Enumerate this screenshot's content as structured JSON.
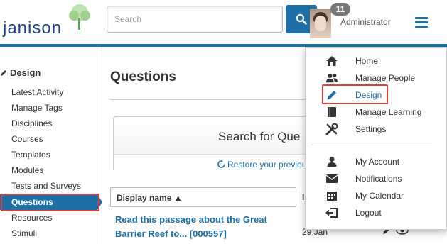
{
  "header": {
    "logo_text": "janison",
    "search_placeholder": "Search",
    "notification_count": "11",
    "username": "Administrator"
  },
  "sidebar": {
    "title": "Design",
    "items": [
      {
        "label": "Latest Activity"
      },
      {
        "label": "Manage Tags"
      },
      {
        "label": "Disciplines"
      },
      {
        "label": "Courses"
      },
      {
        "label": "Templates"
      },
      {
        "label": "Modules"
      },
      {
        "label": "Tests and Surveys"
      },
      {
        "label": "Questions",
        "active": true
      },
      {
        "label": "Resources"
      },
      {
        "label": "Stimuli"
      }
    ]
  },
  "main": {
    "title": "Questions",
    "search_panel_title": "Search for Que",
    "restore_link": "Restore your previou",
    "table": {
      "col_display_name": "Display name ▲",
      "col_second": "I",
      "rows": [
        {
          "name": "Read this passage about the Great Barrier Reef to... [000557]",
          "date": "29 Jan"
        }
      ]
    }
  },
  "dropdown": {
    "items": [
      {
        "label": "Home",
        "icon": "home-icon"
      },
      {
        "label": "Manage People",
        "icon": "people-icon"
      },
      {
        "label": "Design",
        "icon": "pencil-icon",
        "selected": true
      },
      {
        "label": "Manage Learning",
        "icon": "book-icon"
      },
      {
        "label": "Settings",
        "icon": "tools-icon"
      },
      {
        "label": "My Account",
        "icon": "user-icon"
      },
      {
        "label": "Notifications",
        "icon": "envelope-icon"
      },
      {
        "label": "My Calendar",
        "icon": "calendar-icon"
      },
      {
        "label": "Logout",
        "icon": "logout-icon"
      }
    ]
  },
  "colors": {
    "primary": "#1d6fa5",
    "highlight": "#d9413a",
    "logo": "#1f3f86"
  }
}
